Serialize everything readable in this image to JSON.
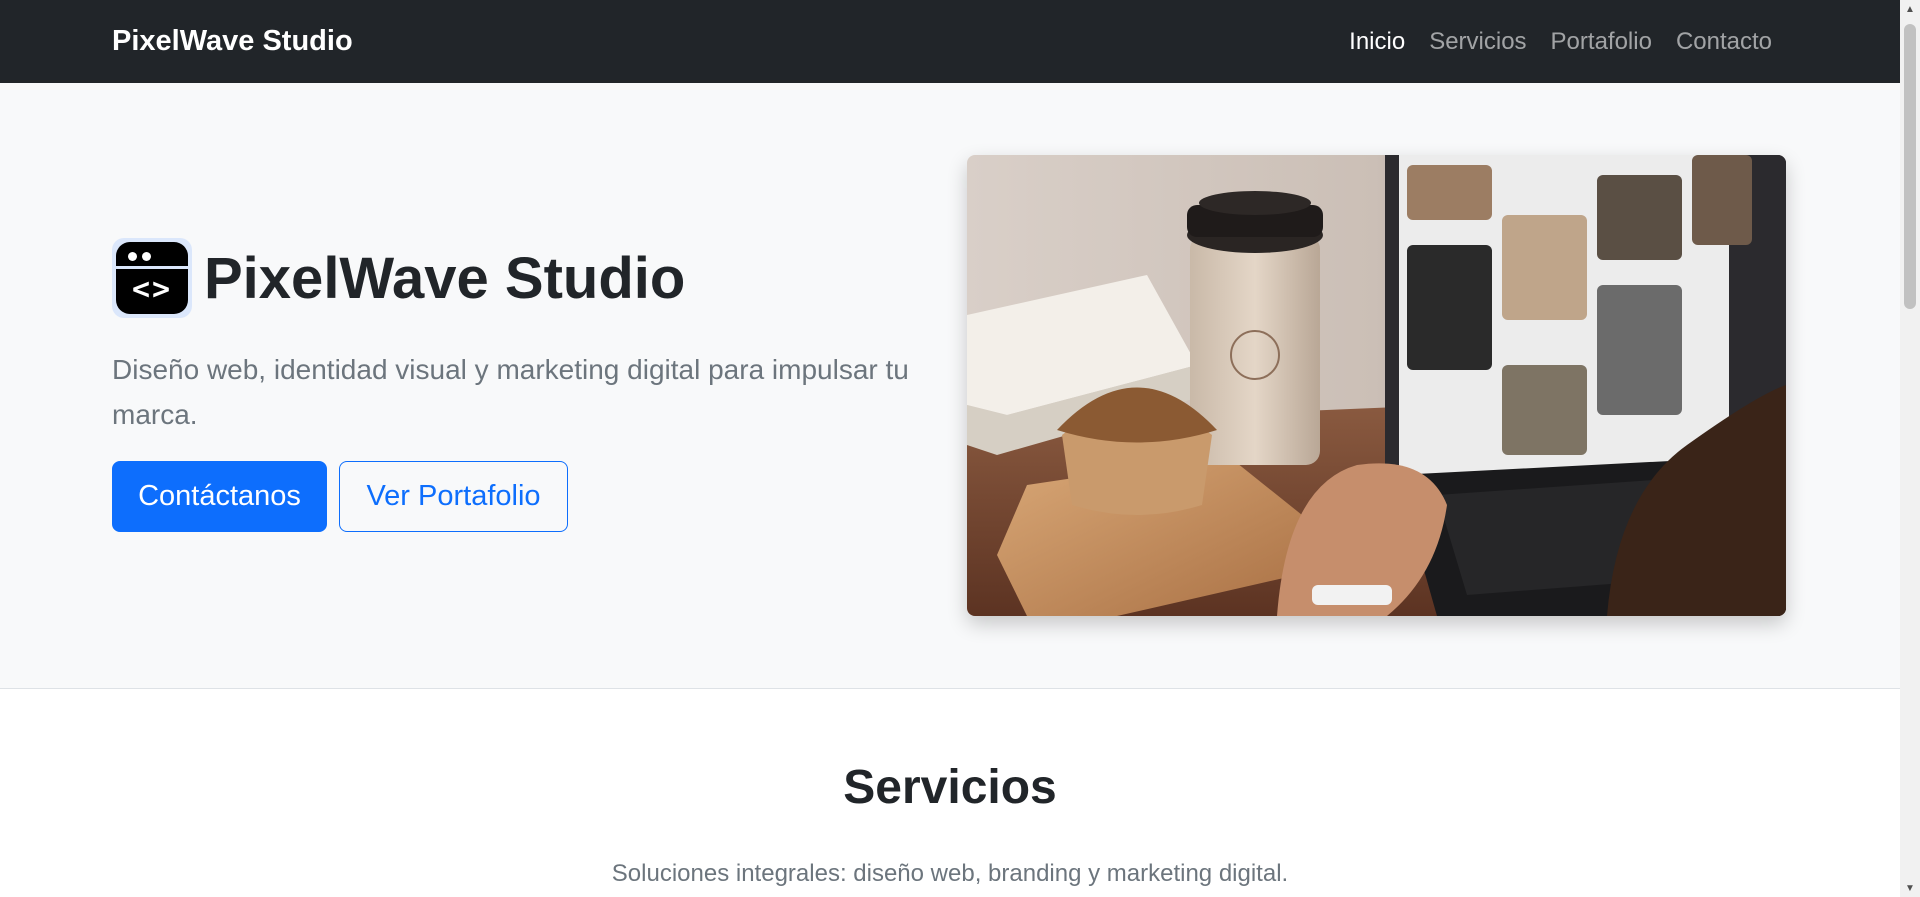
{
  "nav": {
    "brand": "PixelWave Studio",
    "links": [
      {
        "label": "Inicio",
        "active": true
      },
      {
        "label": "Servicios",
        "active": false
      },
      {
        "label": "Portafolio",
        "active": false
      },
      {
        "label": "Contacto",
        "active": false
      }
    ]
  },
  "hero": {
    "logo_icon": "browser-code-icon",
    "logo_glyph": "<>",
    "title": "PixelWave Studio",
    "lead": "Diseño web, identidad visual y marketing digital para impulsar tu marca.",
    "primary_button": "Contáctanos",
    "secondary_button": "Ver Portafolio",
    "image_alt": "workspace-photo"
  },
  "services": {
    "title": "Servicios",
    "subtitle": "Soluciones integrales: diseño web, branding y marketing digital."
  },
  "colors": {
    "navbar_bg": "#212529",
    "hero_bg": "#f8f9fa",
    "primary": "#0d6efd",
    "muted": "#6c757d"
  }
}
